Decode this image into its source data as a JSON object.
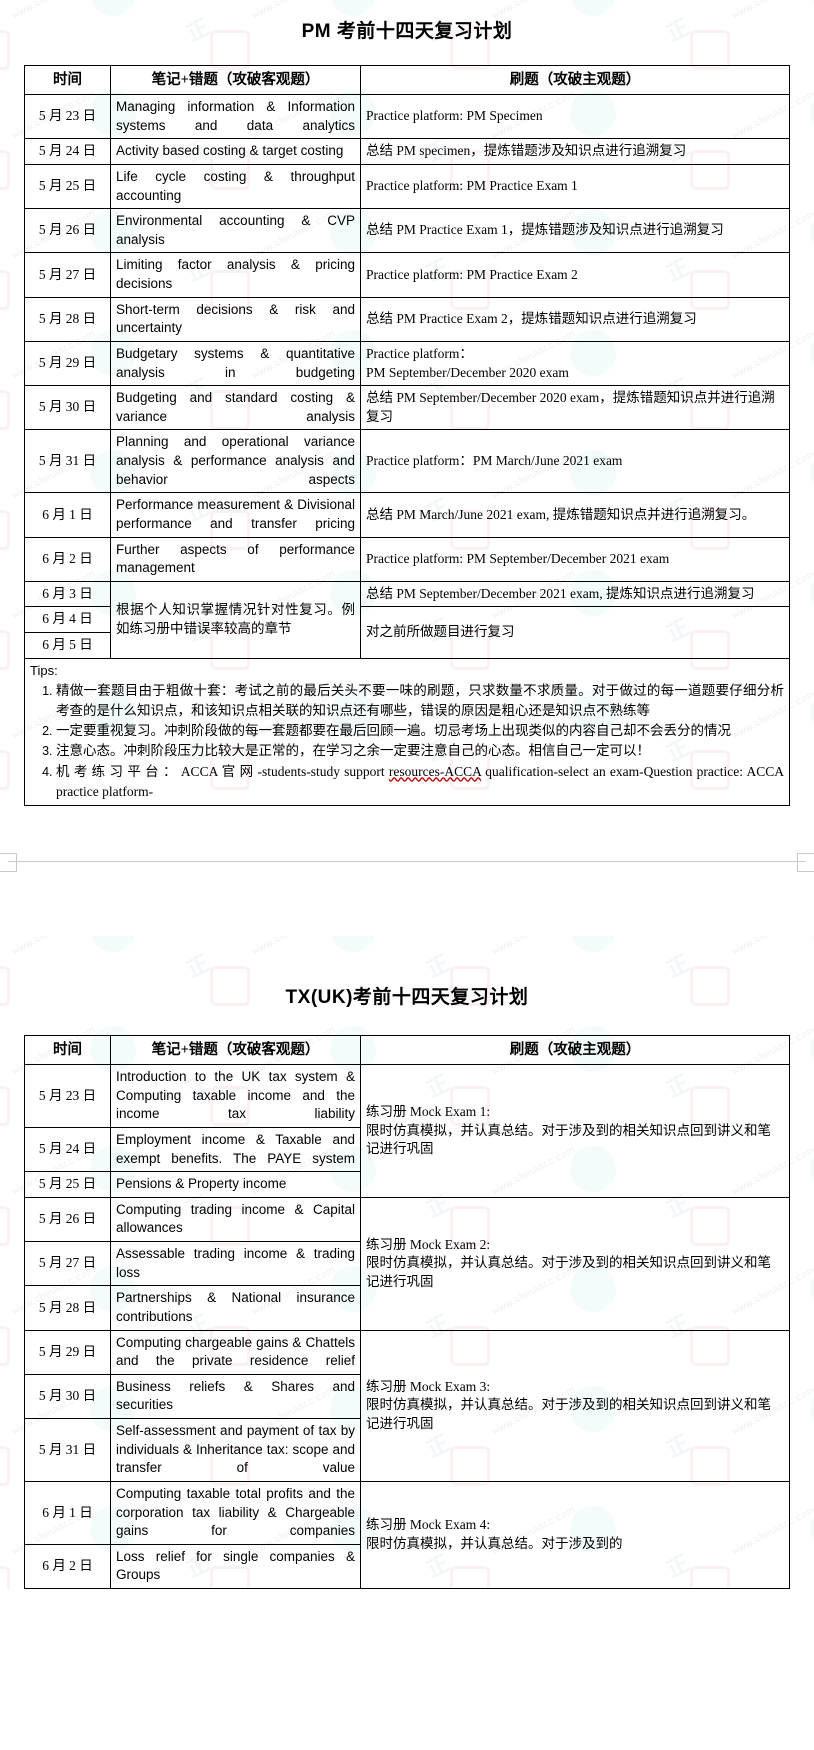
{
  "doc": {
    "page1_title": "PM 考前十四天复习计划",
    "page2_title": "TX(UK)考前十四天复习计划"
  },
  "table_headers": {
    "time": "时间",
    "notes": "笔记+错题（攻破客观题）",
    "drill": "刷题（攻破主观题）"
  },
  "pm_rows": [
    {
      "date": "5 月 23 日",
      "notes": "Managing information & Information systems and data analytics",
      "drill": "Practice platform: PM Specimen"
    },
    {
      "date": "5 月 24 日",
      "notes": "Activity based costing & target costing",
      "drill": "总结 PM specimen，提炼错题涉及知识点进行追溯复习"
    },
    {
      "date": "5 月 25 日",
      "notes": "Life cycle costing & throughput accounting",
      "drill": "Practice platform: PM Practice Exam 1"
    },
    {
      "date": "5 月 26 日",
      "notes": "Environmental accounting & CVP analysis",
      "drill": "总结 PM Practice Exam 1，提炼错题涉及知识点进行追溯复习"
    },
    {
      "date": "5 月 27 日",
      "notes": "Limiting factor analysis & pricing decisions",
      "drill": "Practice platform: PM Practice Exam 2"
    },
    {
      "date": "5 月 28 日",
      "notes": "Short-term decisions & risk and uncertainty",
      "drill": "总结 PM Practice Exam 2，提炼错题知识点进行追溯复习"
    },
    {
      "date": "5 月 29 日",
      "notes": "Budgetary systems & quantitative analysis in budgeting",
      "drill": "Practice platform：\nPM September/December 2020 exam"
    },
    {
      "date": "5 月 30 日",
      "notes": "Budgeting and standard costing & variance analysis",
      "drill": "总结 PM September/December 2020 exam，提炼错题知识点并进行追溯复习"
    },
    {
      "date": "5 月 31 日",
      "notes": "Planning and operational variance analysis & performance analysis and behavior aspects",
      "drill": "Practice platform：PM March/June 2021 exam"
    },
    {
      "date": "6 月 1 日",
      "notes": "Performance measurement & Divisional performance and transfer pricing",
      "drill": "总结 PM March/June 2021 exam, 提炼错题知识点并进行追溯复习。"
    },
    {
      "date": "6 月 2 日",
      "notes": "Further aspects of performance management",
      "drill": "Practice platform: PM September/December 2021 exam"
    }
  ],
  "pm_merged": {
    "dates": [
      "6 月 3 日",
      "6 月 4 日",
      "6 月 5 日"
    ],
    "notes": "根据个人知识掌握情况针对性复习。例如练习册中错误率较高的章节",
    "drill_1": "总结 PM September/December 2021 exam, 提炼知识点进行追溯复习",
    "drill_2": "对之前所做题目进行复习"
  },
  "tips": {
    "heading": "Tips:",
    "items": [
      "精做一套题目由于粗做十套：考试之前的最后关头不要一味的刷题，只求数量不求质量。对于做过的每一道题要仔细分析考查的是什么知识点，和该知识点相关联的知识点还有哪些，错误的原因是粗心还是知识点不熟练等",
      "一定要重视复习。冲刺阶段做的每一套题都要在最后回顾一遍。切忌考场上出现类似的内容自己却不会丢分的情况",
      "注意心态。冲刺阶段压力比较大是正常的，在学习之余一定要注意自己的心态。相信自己一定可以！"
    ],
    "item4": {
      "label": "机考练习平台：",
      "part1": "ACCA ",
      "label2": "官网",
      "part2": "-students-study support ",
      "squiggle": "resources-ACCA",
      "part3": " qualification-select an exam-Question practice: ACCA practice platform-"
    }
  },
  "tx_rows": [
    {
      "date": "5 月 23 日",
      "notes": "Introduction to the UK tax system & Computing taxable income and the income tax liability"
    },
    {
      "date": "5 月 24 日",
      "notes": "Employment income & Taxable and exempt benefits. The PAYE system"
    },
    {
      "date": "5 月 25 日",
      "notes": "Pensions & Property income"
    },
    {
      "date": "5 月 26 日",
      "notes": "Computing trading income & Capital allowances"
    },
    {
      "date": "5 月 27 日",
      "notes": "Assessable trading income & trading loss"
    },
    {
      "date": "5 月 28 日",
      "notes": "Partnerships & National insurance contributions"
    },
    {
      "date": "5 月 29 日",
      "notes": "Computing chargeable gains & Chattels and the private residence relief"
    },
    {
      "date": "5 月 30 日",
      "notes": "Business reliefs & Shares and securities"
    },
    {
      "date": "5 月 31 日",
      "notes": "Self-assessment and payment of tax by individuals & Inheritance tax: scope and transfer  of value"
    },
    {
      "date": "6 月 1 日",
      "notes": "Computing taxable total profits and the corporation tax liability & Chargeable gains for companies"
    },
    {
      "date": "6 月 2 日",
      "notes": "Loss relief for single companies & Groups"
    }
  ],
  "tx_drills": [
    "练习册  Mock Exam 1:\n限时仿真模拟，并认真总结。对于涉及到的相关知识点回到讲义和笔记进行巩固",
    "练习册  Mock Exam 2:\n限时仿真模拟，并认真总结。对于涉及到的相关知识点回到讲义和笔记进行巩固",
    "练习册  Mock Exam 3:\n限时仿真模拟，并认真总结。对于涉及到的相关知识点回到讲义和笔记进行巩固",
    "练习册  Mock Exam 4:\n限时仿真模拟，并认真总结。对于涉及到的"
  ],
  "watermark": {
    "url": "www.chinaacc.com",
    "brand": "正保会计网校"
  }
}
